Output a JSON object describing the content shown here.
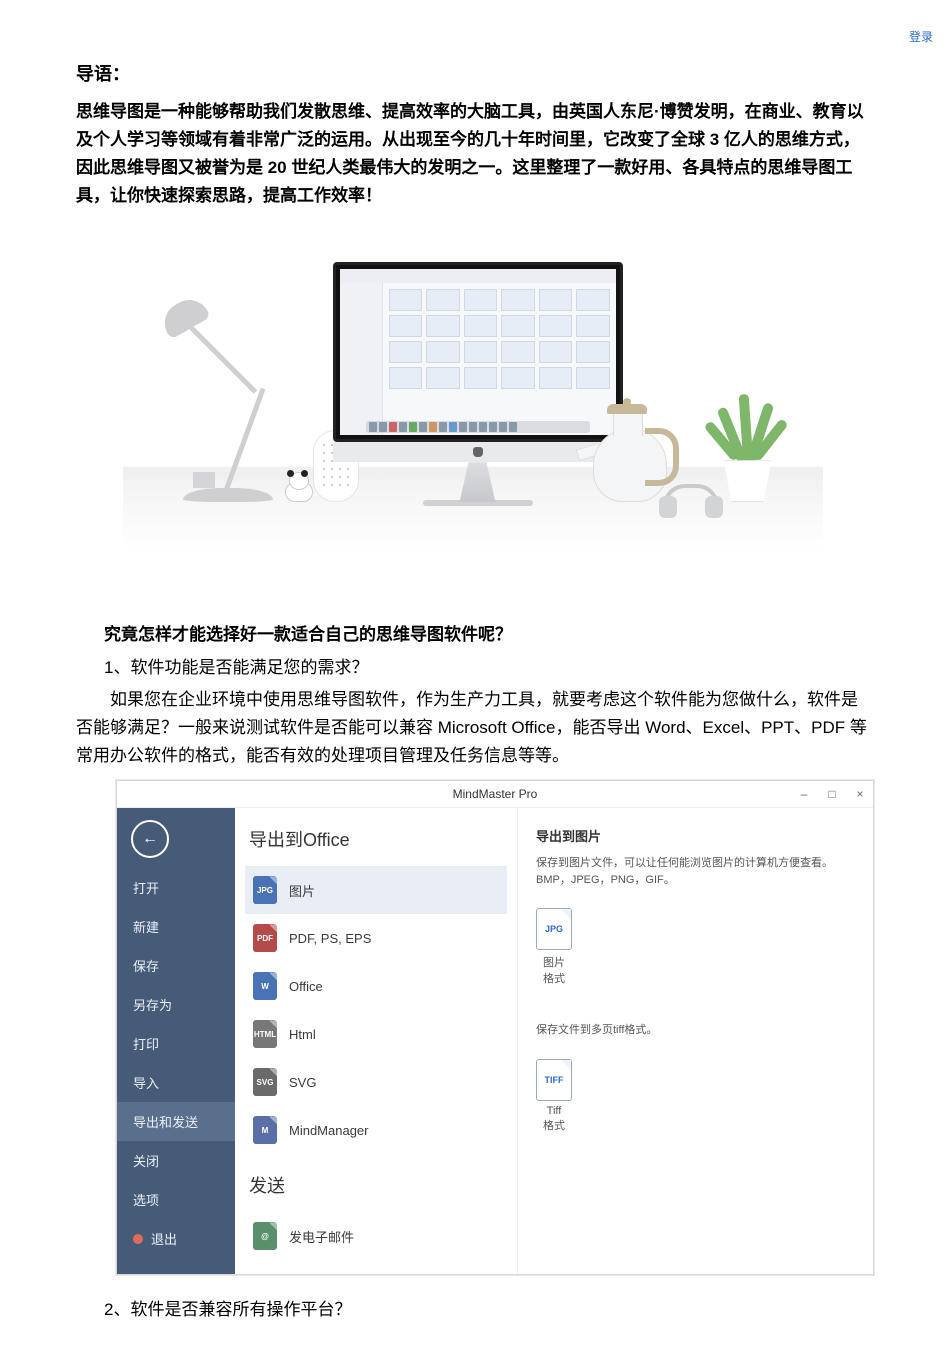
{
  "heading": "导语：",
  "intro": "思维导图是一种能够帮助我们发散思维、提高效率的大脑工具，由英国人东尼·博赞发明，在商业、教育以及个人学习等领域有着非常广泛的运用。从出现至今的几十年时间里，它改变了全球 3 亿人的思维方式，因此思维导图又被誉为是 20 世纪人类最伟大的发明之一。这里整理了一款好用、各具特点的思维导图工具，让你快速探索思路，提高工作效率！",
  "question": "究竟怎样才能选择好一款适合自己的思维导图软件呢？",
  "point1_title": "1、软件功能是否能满足您的需求？",
  "point1_body": "如果您在企业环境中使用思维导图软件，作为生产力工具，就要考虑这个软件能为您做什么，软件是否能够满足？一般来说测试软件是否能可以兼容 Microsoft Office，能否导出 Word、Excel、PPT、PDF 等常用办公软件的格式，能否有效的处理项目管理及任务信息等等。",
  "point2_title": "2、软件是否兼容所有操作平台？",
  "app": {
    "title": "MindMaster Pro",
    "login": "登录",
    "win_min": "–",
    "win_max": "□",
    "win_close": "×",
    "nav": {
      "open": "打开",
      "new": "新建",
      "save": "保存",
      "saveas": "另存为",
      "print": "打印",
      "import": "导入",
      "export": "导出和发送",
      "close": "关闭",
      "options": "选项",
      "exit": "退出"
    },
    "mid": {
      "group_export": "导出到Office",
      "items": [
        {
          "label": "图片",
          "icon": "JPG",
          "cls": "jpg",
          "sel": true
        },
        {
          "label": "PDF, PS, EPS",
          "icon": "PDF",
          "cls": "pdf"
        },
        {
          "label": "Office",
          "icon": "W",
          "cls": "word"
        },
        {
          "label": "Html",
          "icon": "HTML",
          "cls": "html"
        },
        {
          "label": "SVG",
          "icon": "SVG",
          "cls": "svg"
        },
        {
          "label": "MindManager",
          "icon": "M",
          "cls": "mm"
        }
      ],
      "group_send": "发送",
      "send_item": {
        "label": "发电子邮件",
        "icon": "@",
        "cls": "mail"
      }
    },
    "right": {
      "title": "导出到图片",
      "desc": "保存到图片文件，可以让任何能浏览图片的计算机方便查看。 BMP，JPEG，PNG，GIF。",
      "fmt1_icon": "JPG",
      "fmt1_name": "图片",
      "fmt1_sub": "格式",
      "desc2": "保存文件到多页tiff格式。",
      "fmt2_icon": "TIFF",
      "fmt2_name": "Tiff",
      "fmt2_sub": "格式"
    }
  }
}
